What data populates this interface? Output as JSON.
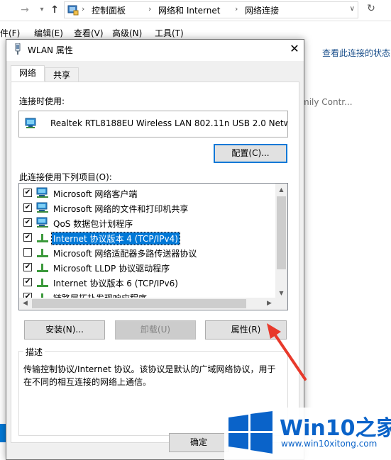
{
  "explorer": {
    "breadcrumbs": [
      "控制面板",
      "网络和 Internet",
      "网络连接"
    ],
    "menus": [
      "件(F)",
      "编辑(E)",
      "查看(V)",
      "高级(N)",
      "工具(T)"
    ],
    "command_text": "查看此连接的状态",
    "family_text": "mily Contr..."
  },
  "dialog": {
    "title": "WLAN 属性",
    "tabs": [
      {
        "label": "网络",
        "active": true
      },
      {
        "label": "共享",
        "active": false
      }
    ],
    "connect_label": "连接时使用:",
    "adapter_name": "Realtek RTL8188EU Wireless LAN 802.11n USB 2.0 Netw",
    "configure_label": "配置(C)...",
    "items_label": "此连接使用下列项目(O):",
    "items": [
      {
        "label": "Microsoft 网络客户端",
        "checked": true,
        "icon": "network-client-icon"
      },
      {
        "label": "Microsoft 网络的文件和打印机共享",
        "checked": true,
        "icon": "file-printer-sharing-icon"
      },
      {
        "label": "QoS 数据包计划程序",
        "checked": true,
        "icon": "qos-scheduler-icon"
      },
      {
        "label": "Internet 协议版本 4 (TCP/IPv4)",
        "checked": true,
        "selected": true,
        "icon": "protocol-icon"
      },
      {
        "label": "Microsoft 网络适配器多路传送器协议",
        "checked": false,
        "icon": "protocol-icon"
      },
      {
        "label": "Microsoft LLDP 协议驱动程序",
        "checked": true,
        "icon": "protocol-icon"
      },
      {
        "label": "Internet 协议版本 6 (TCP/IPv6)",
        "checked": true,
        "icon": "protocol-icon"
      },
      {
        "label": "链路层拓扑发现响应程序",
        "checked": true,
        "icon": "protocol-icon"
      }
    ],
    "install_label": "安装(N)...",
    "uninstall_label": "卸载(U)",
    "properties_label": "属性(R)",
    "description_title": "描述",
    "description_text": "传输控制协议/Internet 协议。该协议是默认的广域网络协议，用于在不同的相互连接的网络上通信。",
    "ok_label": "确定",
    "cancel_label": ""
  },
  "watermark": {
    "brand": "Win10之家",
    "url": "www.win10xitong.com"
  },
  "colors": {
    "accent": "#0078d7",
    "arrow": "#e8392b",
    "watermark": "#0a63c9"
  }
}
